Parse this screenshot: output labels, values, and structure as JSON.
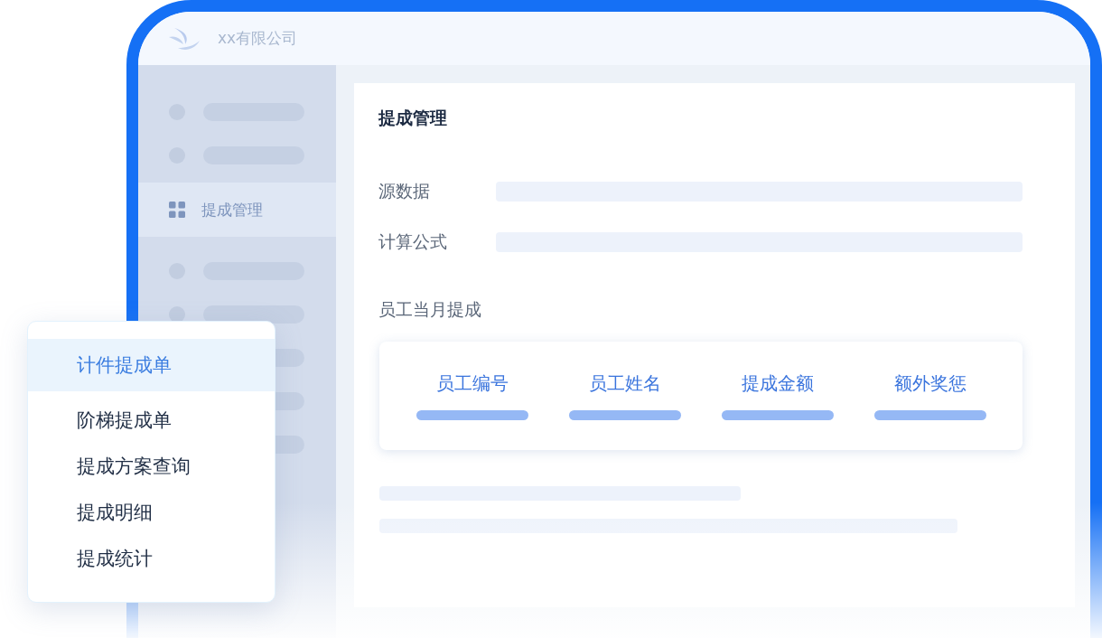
{
  "window": {
    "title": "xx有限公司"
  },
  "sidebar": {
    "items": [
      {
        "label": "提成管理",
        "selected": true
      }
    ]
  },
  "page": {
    "title": "提成管理",
    "fields": [
      {
        "label": "源数据"
      },
      {
        "label": "计算公式"
      }
    ],
    "section_title": "员工当月提成",
    "table": {
      "columns": [
        "员工编号",
        "员工姓名",
        "提成金额",
        "额外奖惩"
      ]
    }
  },
  "menu": {
    "items": [
      {
        "label": "计件提成单",
        "selected": true
      },
      {
        "label": "阶梯提成单",
        "selected": false
      },
      {
        "label": "提成方案查询",
        "selected": false
      },
      {
        "label": "提成明细",
        "selected": false
      },
      {
        "label": "提成统计",
        "selected": false
      }
    ]
  }
}
